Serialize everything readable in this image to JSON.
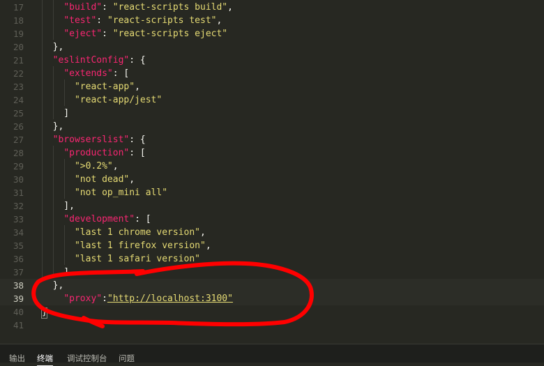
{
  "editor": {
    "lines": [
      {
        "n": "17",
        "tokens": [
          {
            "t": "    "
          },
          {
            "t": "\"build\"",
            "c": "k"
          },
          {
            "t": ": "
          },
          {
            "t": "\"react-scripts build\"",
            "c": "s"
          },
          {
            "t": ","
          }
        ]
      },
      {
        "n": "18",
        "tokens": [
          {
            "t": "    "
          },
          {
            "t": "\"test\"",
            "c": "k"
          },
          {
            "t": ": "
          },
          {
            "t": "\"react-scripts test\"",
            "c": "s"
          },
          {
            "t": ","
          }
        ]
      },
      {
        "n": "19",
        "tokens": [
          {
            "t": "    "
          },
          {
            "t": "\"eject\"",
            "c": "k"
          },
          {
            "t": ": "
          },
          {
            "t": "\"react-scripts eject\"",
            "c": "s"
          }
        ]
      },
      {
        "n": "20",
        "tokens": [
          {
            "t": "  },"
          }
        ]
      },
      {
        "n": "21",
        "tokens": [
          {
            "t": "  "
          },
          {
            "t": "\"eslintConfig\"",
            "c": "k"
          },
          {
            "t": ": {"
          }
        ]
      },
      {
        "n": "22",
        "tokens": [
          {
            "t": "    "
          },
          {
            "t": "\"extends\"",
            "c": "k"
          },
          {
            "t": ": ["
          }
        ]
      },
      {
        "n": "23",
        "tokens": [
          {
            "t": "      "
          },
          {
            "t": "\"react-app\"",
            "c": "s"
          },
          {
            "t": ","
          }
        ]
      },
      {
        "n": "24",
        "tokens": [
          {
            "t": "      "
          },
          {
            "t": "\"react-app/jest\"",
            "c": "s"
          }
        ]
      },
      {
        "n": "25",
        "tokens": [
          {
            "t": "    ]"
          }
        ]
      },
      {
        "n": "26",
        "tokens": [
          {
            "t": "  },"
          }
        ]
      },
      {
        "n": "27",
        "tokens": [
          {
            "t": "  "
          },
          {
            "t": "\"browserslist\"",
            "c": "k"
          },
          {
            "t": ": {"
          }
        ]
      },
      {
        "n": "28",
        "tokens": [
          {
            "t": "    "
          },
          {
            "t": "\"production\"",
            "c": "k"
          },
          {
            "t": ": ["
          }
        ]
      },
      {
        "n": "29",
        "tokens": [
          {
            "t": "      "
          },
          {
            "t": "\">0.2%\"",
            "c": "s"
          },
          {
            "t": ","
          }
        ]
      },
      {
        "n": "30",
        "tokens": [
          {
            "t": "      "
          },
          {
            "t": "\"not dead\"",
            "c": "s"
          },
          {
            "t": ","
          }
        ]
      },
      {
        "n": "31",
        "tokens": [
          {
            "t": "      "
          },
          {
            "t": "\"not op_mini all\"",
            "c": "s"
          }
        ]
      },
      {
        "n": "32",
        "tokens": [
          {
            "t": "    ],"
          }
        ]
      },
      {
        "n": "33",
        "tokens": [
          {
            "t": "    "
          },
          {
            "t": "\"development\"",
            "c": "k"
          },
          {
            "t": ": ["
          }
        ]
      },
      {
        "n": "34",
        "tokens": [
          {
            "t": "      "
          },
          {
            "t": "\"last 1 chrome version\"",
            "c": "s"
          },
          {
            "t": ","
          }
        ]
      },
      {
        "n": "35",
        "tokens": [
          {
            "t": "      "
          },
          {
            "t": "\"last 1 firefox version\"",
            "c": "s"
          },
          {
            "t": ","
          }
        ]
      },
      {
        "n": "36",
        "tokens": [
          {
            "t": "      "
          },
          {
            "t": "\"last 1 safari version\"",
            "c": "s"
          }
        ]
      },
      {
        "n": "37",
        "tokens": [
          {
            "t": "    ]"
          }
        ]
      },
      {
        "n": "38",
        "current": true,
        "tokens": [
          {
            "t": "  },"
          }
        ]
      },
      {
        "n": "39",
        "current": true,
        "tokens": [
          {
            "t": "    "
          },
          {
            "t": "\"proxy\"",
            "c": "k"
          },
          {
            "t": ":"
          },
          {
            "t": "\"http://localhost:3100\"",
            "c": "s u"
          }
        ]
      },
      {
        "n": "40",
        "tokens": [
          {
            "t": "}"
          }
        ]
      },
      {
        "n": "41",
        "tokens": []
      }
    ]
  },
  "panel": {
    "tabs": [
      {
        "label": "输出",
        "active": false,
        "name": "tab-output"
      },
      {
        "label": "终端",
        "active": true,
        "name": "tab-terminal"
      },
      {
        "label": "调试控制台",
        "active": false,
        "name": "tab-debug-console"
      },
      {
        "label": "问题",
        "active": false,
        "name": "tab-problems"
      }
    ]
  },
  "colors": {
    "background": "#272822",
    "key": "#f92672",
    "string": "#e6db74",
    "punctuation": "#f8f8f2",
    "annotation": "#ff0000",
    "modified_gutter": "#1a8cb8"
  }
}
